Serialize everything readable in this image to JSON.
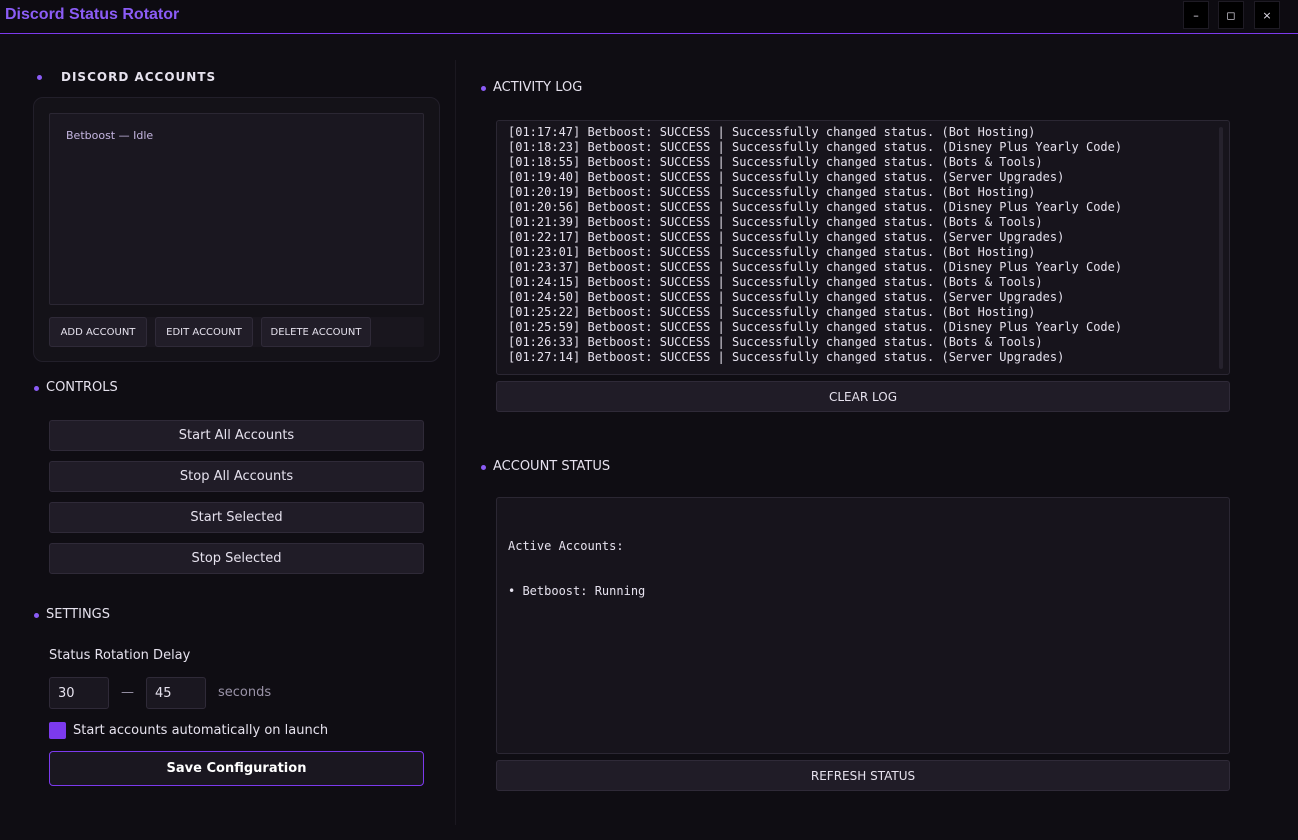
{
  "window": {
    "title": "Discord Status Rotator",
    "minimize_glyph": "–",
    "maximize_glyph": "◻",
    "close_glyph": "×"
  },
  "accounts": {
    "section_title": "DISCORD ACCOUNTS",
    "items": [
      "Betboost  —  Idle"
    ],
    "add_label": "ADD ACCOUNT",
    "edit_label": "EDIT ACCOUNT",
    "delete_label": "DELETE ACCOUNT"
  },
  "controls": {
    "section_title": "CONTROLS",
    "start_all": "Start All Accounts",
    "stop_all": "Stop All Accounts",
    "start_selected": "Start Selected",
    "stop_selected": "Stop Selected"
  },
  "settings": {
    "section_title": "SETTINGS",
    "delay_label": "Status Rotation Delay",
    "min_delay": "30",
    "range_separator": "—",
    "max_delay": "45",
    "unit": "seconds",
    "autostart_label": "Start accounts automatically on launch",
    "autostart_checked": true,
    "save_label": "Save Configuration"
  },
  "activity_log": {
    "section_title": "ACTIVITY LOG",
    "lines": [
      "[01:17:47] Betboost: SUCCESS | Successfully changed status. (Bot Hosting)",
      "[01:18:23] Betboost: SUCCESS | Successfully changed status. (Disney Plus Yearly Code)",
      "[01:18:55] Betboost: SUCCESS | Successfully changed status. (Bots & Tools)",
      "[01:19:40] Betboost: SUCCESS | Successfully changed status. (Server Upgrades)",
      "[01:20:19] Betboost: SUCCESS | Successfully changed status. (Bot Hosting)",
      "[01:20:56] Betboost: SUCCESS | Successfully changed status. (Disney Plus Yearly Code)",
      "[01:21:39] Betboost: SUCCESS | Successfully changed status. (Bots & Tools)",
      "[01:22:17] Betboost: SUCCESS | Successfully changed status. (Server Upgrades)",
      "[01:23:01] Betboost: SUCCESS | Successfully changed status. (Bot Hosting)",
      "[01:23:37] Betboost: SUCCESS | Successfully changed status. (Disney Plus Yearly Code)",
      "[01:24:15] Betboost: SUCCESS | Successfully changed status. (Bots & Tools)",
      "[01:24:50] Betboost: SUCCESS | Successfully changed status. (Server Upgrades)",
      "[01:25:22] Betboost: SUCCESS | Successfully changed status. (Bot Hosting)",
      "[01:25:59] Betboost: SUCCESS | Successfully changed status. (Disney Plus Yearly Code)",
      "[01:26:33] Betboost: SUCCESS | Successfully changed status. (Bots & Tools)",
      "[01:27:14] Betboost: SUCCESS | Successfully changed status. (Server Upgrades)"
    ],
    "clear_label": "CLEAR LOG"
  },
  "account_status": {
    "section_title": "ACCOUNT STATUS",
    "heading": "Active Accounts:",
    "lines": [
      "• Betboost: Running"
    ],
    "refresh_label": "REFRESH STATUS"
  },
  "colors": {
    "accent": "#7c3aed",
    "accent_light": "#8b5cf6",
    "background": "#0f0d13"
  }
}
